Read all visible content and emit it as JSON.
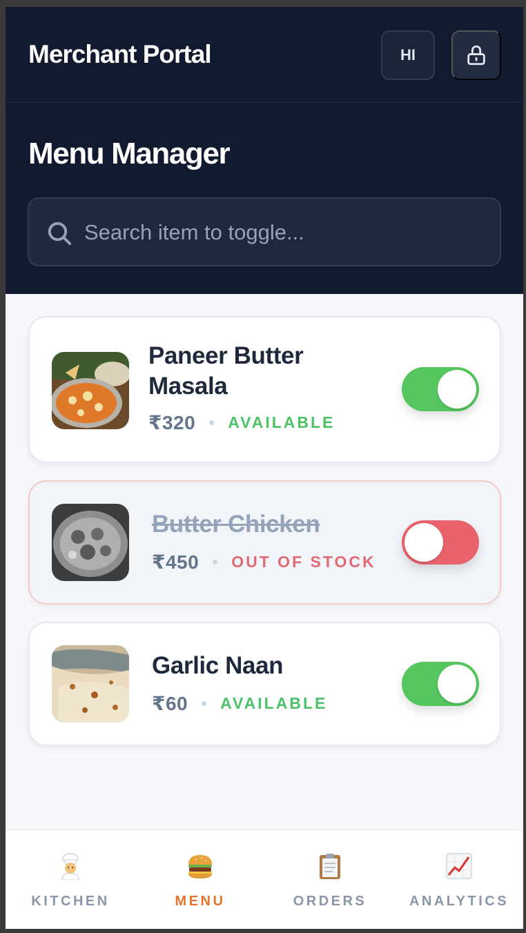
{
  "header": {
    "app_title": "Merchant Portal",
    "language_button": "HI",
    "lock_icon": "lock-icon",
    "page_title": "Menu Manager",
    "search": {
      "placeholder": "Search item to toggle...",
      "value": ""
    }
  },
  "items": [
    {
      "name": "Paneer Butter Masala",
      "price": "₹320",
      "status": "AVAILABLE",
      "available": true
    },
    {
      "name": "Butter Chicken",
      "price": "₹450",
      "status": "OUT OF STOCK",
      "available": false
    },
    {
      "name": "Garlic Naan",
      "price": "₹60",
      "status": "AVAILABLE",
      "available": true
    }
  ],
  "nav": {
    "active": "MENU",
    "items": [
      {
        "label": "KITCHEN",
        "icon": "chef-icon"
      },
      {
        "label": "MENU",
        "icon": "burger-icon"
      },
      {
        "label": "ORDERS",
        "icon": "clipboard-icon"
      },
      {
        "label": "ANALYTICS",
        "icon": "chart-up-icon"
      }
    ]
  },
  "colors": {
    "header_bg": "#111a2e",
    "available": "#4cc266",
    "out_of_stock": "#e06b73",
    "active_nav": "#e8732a"
  }
}
